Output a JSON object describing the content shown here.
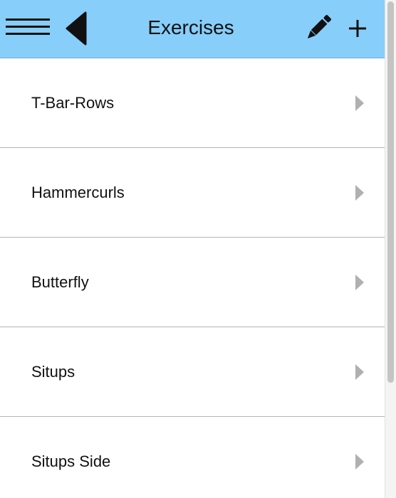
{
  "header": {
    "title": "Exercises",
    "background": "#87cefa",
    "icons": {
      "menu": "hamburger-menu-icon",
      "back": "back-triangle-icon",
      "edit": "pencil-icon",
      "add": "plus-icon"
    }
  },
  "exercises": [
    {
      "label": "T-Bar-Rows"
    },
    {
      "label": "Hammercurls"
    },
    {
      "label": "Butterfly"
    },
    {
      "label": "Situps"
    },
    {
      "label": "Situps Side"
    }
  ],
  "colors": {
    "chevron": "#b0b0b0",
    "divider": "#b5b5b5"
  }
}
